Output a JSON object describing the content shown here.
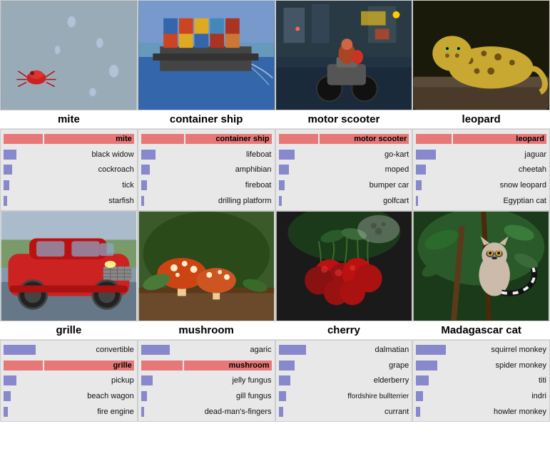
{
  "categories": [
    {
      "id": "mite",
      "label": "mite",
      "bg": "#9aabb8",
      "predictions": [
        {
          "label": "mite",
          "bar": 55,
          "highlight": true
        },
        {
          "label": "black widow",
          "bar": 18,
          "highlight": false
        },
        {
          "label": "cockroach",
          "bar": 12,
          "highlight": false
        },
        {
          "label": "tick",
          "bar": 8,
          "highlight": false
        },
        {
          "label": "starfish",
          "bar": 5,
          "highlight": false
        }
      ]
    },
    {
      "id": "container-ship",
      "label": "container ship",
      "bg": "#5588aa",
      "predictions": [
        {
          "label": "container ship",
          "bar": 60,
          "highlight": true
        },
        {
          "label": "lifeboat",
          "bar": 20,
          "highlight": false
        },
        {
          "label": "amphibian",
          "bar": 12,
          "highlight": false
        },
        {
          "label": "fireboat",
          "bar": 8,
          "highlight": false
        },
        {
          "label": "drilling platform",
          "bar": 4,
          "highlight": false
        }
      ]
    },
    {
      "id": "motor-scooter",
      "label": "motor scooter",
      "bg": "#334455",
      "predictions": [
        {
          "label": "motor scooter",
          "bar": 55,
          "highlight": true
        },
        {
          "label": "go-kart",
          "bar": 22,
          "highlight": false
        },
        {
          "label": "moped",
          "bar": 14,
          "highlight": false
        },
        {
          "label": "bumper car",
          "bar": 8,
          "highlight": false
        },
        {
          "label": "golfcart",
          "bar": 4,
          "highlight": false
        }
      ]
    },
    {
      "id": "leopard",
      "label": "leopard",
      "bg": "#1a1a0a",
      "predictions": [
        {
          "label": "leopard",
          "bar": 50,
          "highlight": true
        },
        {
          "label": "jaguar",
          "bar": 28,
          "highlight": false
        },
        {
          "label": "cheetah",
          "bar": 14,
          "highlight": false
        },
        {
          "label": "snow leopard",
          "bar": 8,
          "highlight": false
        },
        {
          "label": "Egyptian cat",
          "bar": 3,
          "highlight": false
        }
      ]
    },
    {
      "id": "grille",
      "label": "grille",
      "bg": "#bb3322",
      "predictions": [
        {
          "label": "convertible",
          "bar": 45,
          "highlight": false
        },
        {
          "label": "grille",
          "bar": 55,
          "highlight": true
        },
        {
          "label": "pickup",
          "bar": 18,
          "highlight": false
        },
        {
          "label": "beach wagon",
          "bar": 10,
          "highlight": false
        },
        {
          "label": "fire engine",
          "bar": 6,
          "highlight": false
        }
      ]
    },
    {
      "id": "mushroom",
      "label": "mushroom",
      "bg": "#4a6a3a",
      "predictions": [
        {
          "label": "agaric",
          "bar": 40,
          "highlight": false
        },
        {
          "label": "mushroom",
          "bar": 58,
          "highlight": true
        },
        {
          "label": "jelly fungus",
          "bar": 16,
          "highlight": false
        },
        {
          "label": "gill fungus",
          "bar": 8,
          "highlight": false
        },
        {
          "label": "dead-man's-fingers",
          "bar": 4,
          "highlight": false
        }
      ]
    },
    {
      "id": "cherry",
      "label": "cherry",
      "bg": "#222222",
      "predictions": [
        {
          "label": "dalmatian",
          "bar": 38,
          "highlight": false
        },
        {
          "label": "grape",
          "bar": 22,
          "highlight": false
        },
        {
          "label": "elderberry",
          "bar": 16,
          "highlight": false
        },
        {
          "label": "ffordshire bullterrier",
          "bar": 10,
          "highlight": false
        },
        {
          "label": "currant",
          "bar": 6,
          "highlight": false
        }
      ]
    },
    {
      "id": "madagascar-cat",
      "label": "Madagascar cat",
      "bg": "#1a4a1a",
      "predictions": [
        {
          "label": "squirrel monkey",
          "bar": 42,
          "highlight": false
        },
        {
          "label": "spider monkey",
          "bar": 30,
          "highlight": false
        },
        {
          "label": "titi",
          "bar": 18,
          "highlight": false
        },
        {
          "label": "indri",
          "bar": 10,
          "highlight": false
        },
        {
          "label": "howler monkey",
          "bar": 6,
          "highlight": false
        }
      ]
    }
  ]
}
